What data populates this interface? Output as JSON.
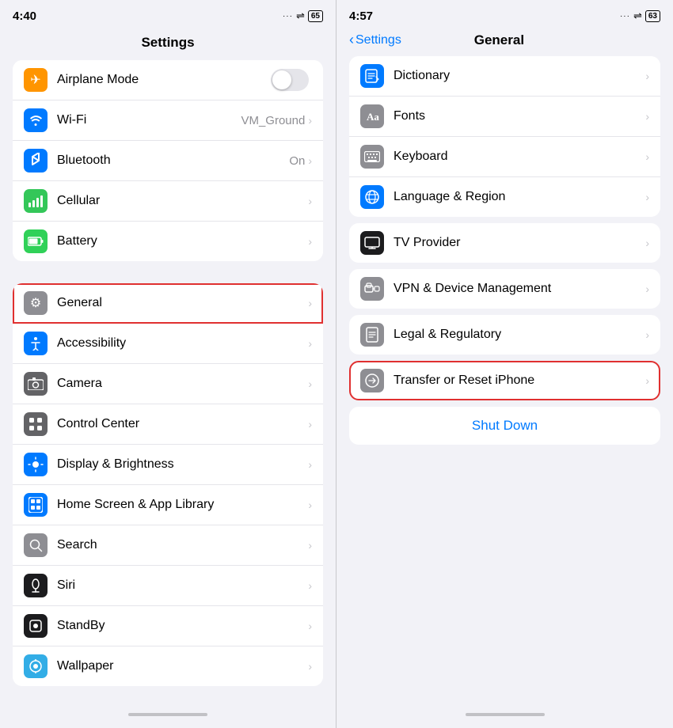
{
  "left": {
    "statusBar": {
      "time": "4:40",
      "signal": "···",
      "wifi": "WiFi",
      "battery": "65"
    },
    "title": "Settings",
    "items": [
      {
        "id": "airplane-mode",
        "label": "Airplane Mode",
        "icon": "✈",
        "iconBg": "bg-orange",
        "type": "toggle",
        "value": ""
      },
      {
        "id": "wifi",
        "label": "Wi-Fi",
        "icon": "📶",
        "iconBg": "bg-blue",
        "type": "value",
        "value": "VM_Ground"
      },
      {
        "id": "bluetooth",
        "label": "Bluetooth",
        "icon": "🔵",
        "iconBg": "bg-blue2",
        "type": "value",
        "value": "On"
      },
      {
        "id": "cellular",
        "label": "Cellular",
        "icon": "📡",
        "iconBg": "bg-green",
        "type": "chevron",
        "value": ""
      },
      {
        "id": "battery",
        "label": "Battery",
        "icon": "🔋",
        "iconBg": "bg-green2",
        "type": "chevron",
        "value": ""
      }
    ],
    "group2": [
      {
        "id": "general",
        "label": "General",
        "icon": "⚙",
        "iconBg": "bg-gray",
        "type": "chevron",
        "highlighted": true
      },
      {
        "id": "accessibility",
        "label": "Accessibility",
        "icon": "♿",
        "iconBg": "bg-blue3",
        "type": "chevron",
        "highlighted": false
      },
      {
        "id": "camera",
        "label": "Camera",
        "icon": "📷",
        "iconBg": "bg-gray2",
        "type": "chevron",
        "highlighted": false
      },
      {
        "id": "control-center",
        "label": "Control Center",
        "icon": "⊞",
        "iconBg": "bg-gray",
        "type": "chevron",
        "highlighted": false
      },
      {
        "id": "display-brightness",
        "label": "Display & Brightness",
        "icon": "☀",
        "iconBg": "bg-blue",
        "type": "chevron",
        "highlighted": false
      },
      {
        "id": "home-screen",
        "label": "Home Screen & App Library",
        "icon": "📱",
        "iconBg": "bg-blue",
        "type": "chevron",
        "highlighted": false
      },
      {
        "id": "search",
        "label": "Search",
        "icon": "🔍",
        "iconBg": "bg-gray",
        "type": "chevron",
        "highlighted": false
      },
      {
        "id": "siri",
        "label": "Siri",
        "icon": "🎙",
        "iconBg": "bg-dark",
        "type": "chevron",
        "highlighted": false
      },
      {
        "id": "standby",
        "label": "StandBy",
        "icon": "⏱",
        "iconBg": "bg-dark",
        "type": "chevron",
        "highlighted": false
      },
      {
        "id": "wallpaper",
        "label": "Wallpaper",
        "icon": "🖼",
        "iconBg": "bg-cyan",
        "type": "chevron",
        "highlighted": false
      }
    ]
  },
  "right": {
    "statusBar": {
      "time": "4:57",
      "signal": "···",
      "wifi": "WiFi",
      "battery": "63"
    },
    "backLabel": "Settings",
    "title": "General",
    "group1": [
      {
        "id": "dictionary",
        "label": "Dictionary",
        "iconBg": "#007aff",
        "iconType": "dictionary"
      },
      {
        "id": "fonts",
        "label": "Fonts",
        "iconBg": "#8e8e93",
        "iconType": "fonts"
      },
      {
        "id": "keyboard",
        "label": "Keyboard",
        "iconBg": "#8e8e93",
        "iconType": "keyboard"
      },
      {
        "id": "language-region",
        "label": "Language & Region",
        "iconBg": "#007aff",
        "iconType": "globe"
      }
    ],
    "group2": [
      {
        "id": "tv-provider",
        "label": "TV Provider",
        "iconBg": "#1c1c1e",
        "iconType": "tv"
      }
    ],
    "group3": [
      {
        "id": "vpn",
        "label": "VPN & Device Management",
        "iconBg": "#8e8e93",
        "iconType": "vpn"
      }
    ],
    "group4": [
      {
        "id": "legal",
        "label": "Legal & Regulatory",
        "iconBg": "#8e8e93",
        "iconType": "legal"
      }
    ],
    "group5": [
      {
        "id": "transfer-reset",
        "label": "Transfer or Reset iPhone",
        "iconBg": "#8e8e93",
        "iconType": "transfer",
        "highlighted": true
      }
    ],
    "shutdownLabel": "Shut Down",
    "chevronLabel": "›"
  }
}
